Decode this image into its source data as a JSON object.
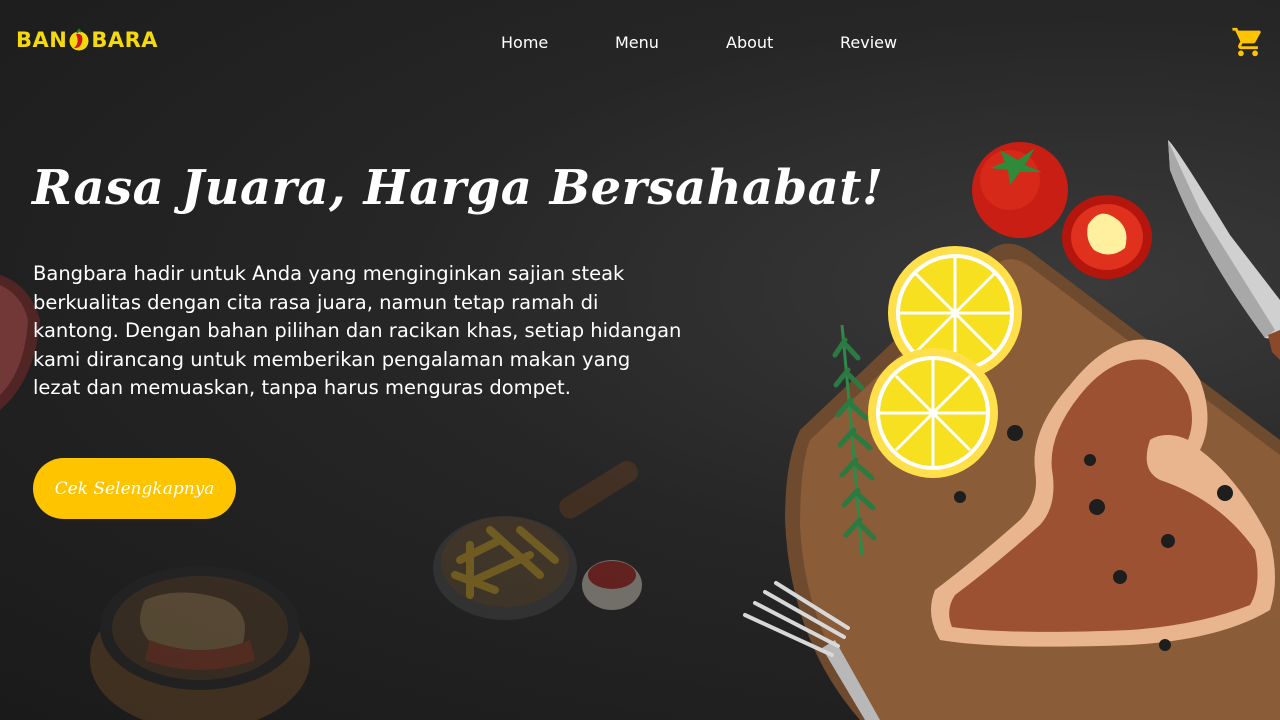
{
  "brand": {
    "name_left": "BAN",
    "name_right": "BARA",
    "color": "#f5d90a"
  },
  "nav": {
    "items": [
      "Home",
      "Menu",
      "About",
      "Review"
    ]
  },
  "cart": {
    "icon": "shopping-cart-icon",
    "color": "#ffc400"
  },
  "hero": {
    "headline": "Rasa Juara, Harga Bersahabat!",
    "description": "Bangbara hadir untuk Anda yang menginginkan sajian steak berkualitas dengan cita rasa juara, namun tetap ramah di kantong. Dengan bahan pilihan dan racikan khas, setiap hidangan kami dirancang untuk memberikan pengalaman makan yang lezat dan memuaskan, tanpa harus menguras dompet.",
    "cta_label": "Cek Selengkapnya",
    "cta_color": "#ffc400"
  },
  "illustrations": [
    "tomato",
    "tomato-slice",
    "lemon-slices",
    "rosemary",
    "knife",
    "fork",
    "cutting-board",
    "steak",
    "peppercorns",
    "fries-pan",
    "ketchup-bowl",
    "sizzling-plate"
  ]
}
